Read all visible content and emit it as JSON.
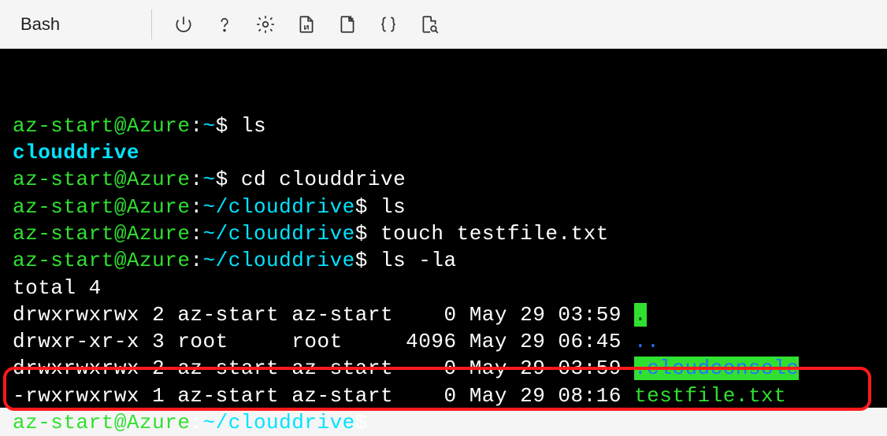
{
  "toolbar": {
    "shell_name": "Bash",
    "icons": [
      "power-icon",
      "help-icon",
      "settings-icon",
      "download-file-icon",
      "new-file-icon",
      "braces-icon",
      "search-file-icon"
    ]
  },
  "prompt": {
    "user": "az-start",
    "host": "Azure",
    "home_sym": "~",
    "sep": ":",
    "dollar": "$"
  },
  "dirs": {
    "clouddrive": "/clouddrive"
  },
  "commands": {
    "ls": "ls",
    "cd_clouddrive": "cd clouddrive",
    "touch": "touch testfile.txt",
    "lsla": "ls -la"
  },
  "output": {
    "clouddrive_word": "clouddrive",
    "total_line": "total 4",
    "rows": [
      {
        "perm": "drwxrwxrwx",
        "links": "2",
        "owner": "az-start",
        "group": "az-start",
        "size": "0",
        "date": "May 29 03:59",
        "name": ".",
        "style": "dot-bg"
      },
      {
        "perm": "drwxr-xr-x",
        "links": "3",
        "owner": "root",
        "group": "root",
        "size": "4096",
        "date": "May 29 06:45",
        "name": "..",
        "style": "blue"
      },
      {
        "perm": "drwxrwxrwx",
        "links": "2",
        "owner": "az-start",
        "group": "az-start",
        "size": "0",
        "date": "May 29 03:59",
        "name": ".cloudconsole",
        "style": "blue-bg"
      },
      {
        "perm": "-rwxrwxrwx",
        "links": "1",
        "owner": "az-start",
        "group": "az-start",
        "size": "0",
        "date": "May 29 08:16",
        "name": "testfile.txt",
        "style": "green"
      }
    ]
  },
  "highlight": {
    "row_index": 3
  }
}
